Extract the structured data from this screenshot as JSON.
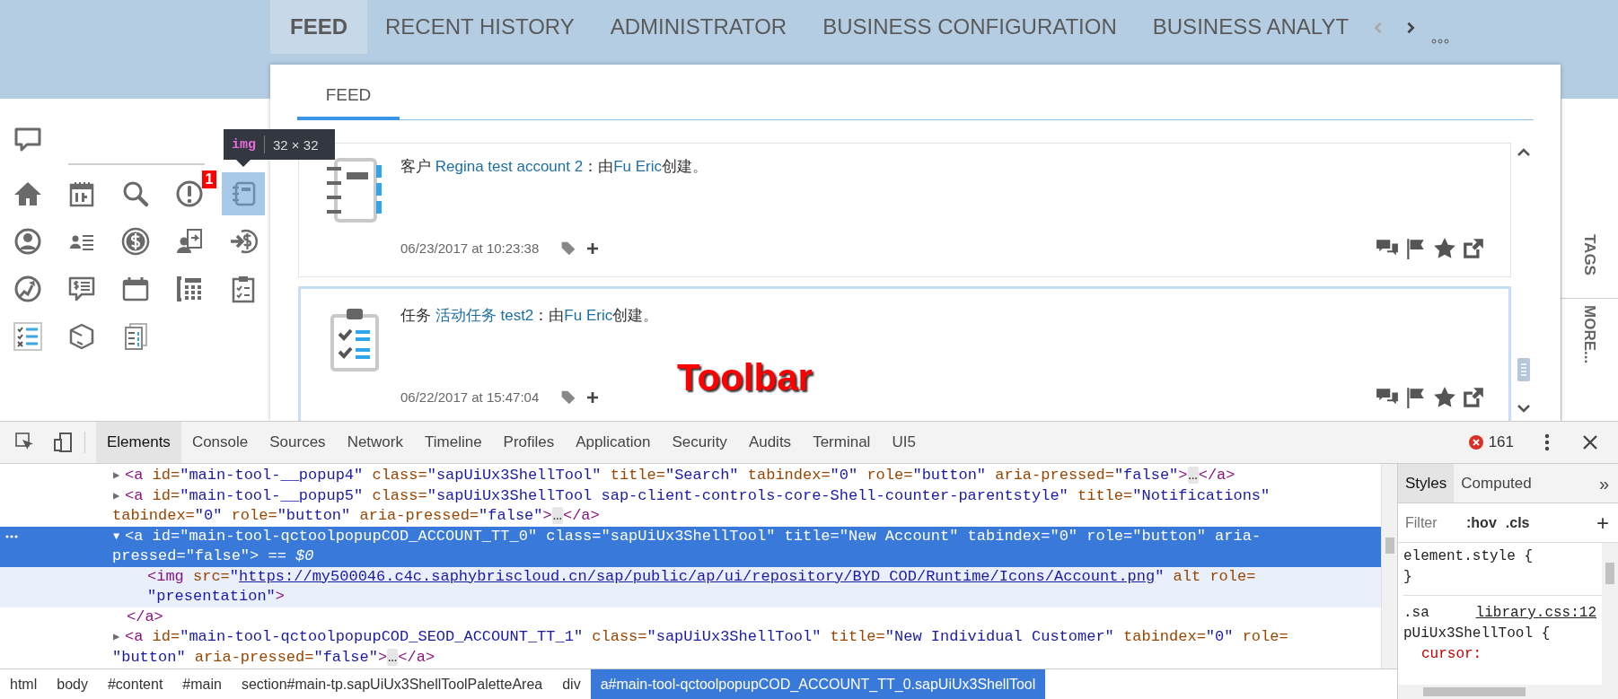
{
  "top_tabs": [
    {
      "label": "FEED",
      "selected": true
    },
    {
      "label": "RECENT HISTORY",
      "selected": false
    },
    {
      "label": "ADMINISTRATOR",
      "selected": false
    },
    {
      "label": "BUSINESS CONFIGURATION",
      "selected": false
    },
    {
      "label": "BUSINESS ANALYT",
      "selected": false
    }
  ],
  "toolbar": {
    "items": [
      {
        "selected": false
      },
      {
        "selected": false
      },
      {
        "selected": false
      },
      {
        "selected": false,
        "badge": "1"
      },
      {
        "selected": true
      },
      {
        "selected": false
      },
      {
        "selected": false
      },
      {
        "selected": false
      },
      {
        "selected": false
      },
      {
        "selected": false
      },
      {
        "selected": false
      },
      {
        "selected": false
      },
      {
        "selected": false
      },
      {
        "selected": false
      },
      {
        "selected": false
      },
      {
        "selected": false
      },
      {
        "selected": false
      },
      {
        "selected": false
      }
    ]
  },
  "inspect_tooltip": {
    "tag": "img",
    "size": "32 × 32"
  },
  "subtabs": [
    {
      "label": "FEED",
      "selected": true
    }
  ],
  "feed": [
    {
      "kind": "account",
      "selected": false,
      "time": "06/23/2017 at 10:23:38",
      "segments": [
        {
          "kind": "text",
          "text": "客户 "
        },
        {
          "kind": "link",
          "text": "Regina test account 2"
        },
        {
          "kind": "text",
          "text": "：由"
        },
        {
          "kind": "link",
          "text": "Fu Eric"
        },
        {
          "kind": "text",
          "text": "创建。"
        }
      ]
    },
    {
      "kind": "task",
      "selected": true,
      "time": "06/22/2017 at 15:47:04",
      "segments": [
        {
          "kind": "text",
          "text": "任务 "
        },
        {
          "kind": "link",
          "text": "活动任务 test2"
        },
        {
          "kind": "text",
          "text": "：由"
        },
        {
          "kind": "link",
          "text": "Fu Eric"
        },
        {
          "kind": "text",
          "text": "创建。"
        }
      ]
    }
  ],
  "side_tabs": [
    {
      "label": "TAGS"
    },
    {
      "label": "MORE..."
    }
  ],
  "annotation": "Toolbar",
  "devtools": {
    "tabs": [
      {
        "label": "Elements",
        "selected": true
      },
      {
        "label": "Console",
        "selected": false
      },
      {
        "label": "Sources",
        "selected": false
      },
      {
        "label": "Network",
        "selected": false
      },
      {
        "label": "Timeline",
        "selected": false
      },
      {
        "label": "Profiles",
        "selected": false
      },
      {
        "label": "Application",
        "selected": false
      },
      {
        "label": "Security",
        "selected": false
      },
      {
        "label": "Audits",
        "selected": false
      },
      {
        "label": "Terminal",
        "selected": false
      },
      {
        "label": "UI5",
        "selected": false
      }
    ],
    "error_count": "161",
    "lines": [
      {
        "kind": "open",
        "toggle": "▶",
        "selected": false,
        "hovered": false,
        "tokens": [
          {
            "kind": "tag",
            "text": "<a"
          },
          {
            "kind": "attr",
            "text": " id="
          },
          {
            "kind": "value",
            "text": "\"main-tool-__popup4\""
          },
          {
            "kind": "attr",
            "text": " class="
          },
          {
            "kind": "value",
            "text": "\"sapUiUx3ShellTool\""
          },
          {
            "kind": "attr",
            "text": " title="
          },
          {
            "kind": "value",
            "text": "\"Search\""
          },
          {
            "kind": "attr",
            "text": " tabindex="
          },
          {
            "kind": "value",
            "text": "\"0\""
          },
          {
            "kind": "attr",
            "text": " role="
          },
          {
            "kind": "value",
            "text": "\"button\""
          },
          {
            "kind": "attr",
            "text": " aria-pressed="
          },
          {
            "kind": "value",
            "text": "\"false\""
          },
          {
            "kind": "tag",
            "text": ">"
          },
          {
            "kind": "ellipsis",
            "text": "…"
          },
          {
            "kind": "tag",
            "text": "</a>"
          }
        ]
      },
      {
        "kind": "open",
        "toggle": "▶",
        "selected": false,
        "hovered": false,
        "tokens": [
          {
            "kind": "tag",
            "text": "<a"
          },
          {
            "kind": "attr",
            "text": " id="
          },
          {
            "kind": "value",
            "text": "\"main-tool-__popup5\""
          },
          {
            "kind": "attr",
            "text": " class="
          },
          {
            "kind": "value",
            "text": "\"sapUiUx3ShellTool sap-client-controls-core-Shell-counter-parentstyle\""
          },
          {
            "kind": "attr",
            "text": " title="
          },
          {
            "kind": "value",
            "text": "\"Notifications\""
          }
        ]
      },
      {
        "kind": "wrap",
        "selected": false,
        "hovered": false,
        "tokens": [
          {
            "kind": "attr",
            "text": "tabindex="
          },
          {
            "kind": "value",
            "text": "\"0\""
          },
          {
            "kind": "attr",
            "text": " role="
          },
          {
            "kind": "value",
            "text": "\"button\""
          },
          {
            "kind": "attr",
            "text": " aria-pressed="
          },
          {
            "kind": "value",
            "text": "\"false\""
          },
          {
            "kind": "tag",
            "text": ">"
          },
          {
            "kind": "ellipsis",
            "text": "…"
          },
          {
            "kind": "tag",
            "text": "</a>"
          }
        ]
      },
      {
        "kind": "open",
        "toggle": "▼",
        "selected": true,
        "hovered": false,
        "tokens": [
          {
            "kind": "tag",
            "text": "<a"
          },
          {
            "kind": "attr",
            "text": " id="
          },
          {
            "kind": "value",
            "text": "\"main-tool-qctoolpopupCOD_ACCOUNT_TT_0\""
          },
          {
            "kind": "attr",
            "text": " class="
          },
          {
            "kind": "value",
            "text": "\"sapUiUx3ShellTool\""
          },
          {
            "kind": "attr",
            "text": " title="
          },
          {
            "kind": "value",
            "text": "\"New Account\""
          },
          {
            "kind": "attr",
            "text": " tabindex="
          },
          {
            "kind": "value",
            "text": "\"0\""
          },
          {
            "kind": "attr",
            "text": " role="
          },
          {
            "kind": "value",
            "text": "\"button\""
          },
          {
            "kind": "attr",
            "text": " aria-"
          }
        ]
      },
      {
        "kind": "wrap",
        "selected": true,
        "hovered": false,
        "tokens": [
          {
            "kind": "attr",
            "text": "pressed="
          },
          {
            "kind": "value",
            "text": "\"false\""
          },
          {
            "kind": "tag",
            "text": ">"
          },
          {
            "kind": "ref",
            "text": " == $0"
          }
        ]
      },
      {
        "kind": "child",
        "selected": false,
        "hovered": true,
        "tokens": [
          {
            "kind": "tag",
            "text": "<img"
          },
          {
            "kind": "attr",
            "text": " src="
          },
          {
            "kind": "value",
            "text": "\""
          },
          {
            "kind": "url",
            "text": "https://my500046.c4c.saphybriscloud.cn/sap/public/ap/ui/repository/BYD_COD/Runtime/Icons/Account.png"
          },
          {
            "kind": "value",
            "text": "\""
          },
          {
            "kind": "attr",
            "text": " alt role="
          }
        ]
      },
      {
        "kind": "child",
        "selected": false,
        "hovered": true,
        "tokens": [
          {
            "kind": "value",
            "text": "\"presentation\""
          },
          {
            "kind": "tag",
            "text": ">"
          }
        ]
      },
      {
        "kind": "close",
        "selected": false,
        "hovered": false,
        "tokens": [
          {
            "kind": "tag",
            "text": "</a>"
          }
        ]
      },
      {
        "kind": "open",
        "toggle": "▶",
        "selected": false,
        "hovered": false,
        "tokens": [
          {
            "kind": "tag",
            "text": "<a"
          },
          {
            "kind": "attr",
            "text": " id="
          },
          {
            "kind": "value",
            "text": "\"main-tool-qctoolpopupCOD_SEOD_ACCOUNT_TT_1\""
          },
          {
            "kind": "attr",
            "text": " class="
          },
          {
            "kind": "value",
            "text": "\"sapUiUx3ShellTool\""
          },
          {
            "kind": "attr",
            "text": " title="
          },
          {
            "kind": "value",
            "text": "\"New Individual Customer\""
          },
          {
            "kind": "attr",
            "text": " tabindex="
          },
          {
            "kind": "value",
            "text": "\"0\""
          },
          {
            "kind": "attr",
            "text": " role="
          }
        ]
      },
      {
        "kind": "wrap",
        "selected": false,
        "hovered": false,
        "tokens": [
          {
            "kind": "value",
            "text": "\"button\""
          },
          {
            "kind": "attr",
            "text": " aria-pressed="
          },
          {
            "kind": "value",
            "text": "\"false\""
          },
          {
            "kind": "tag",
            "text": ">"
          },
          {
            "kind": "ellipsis",
            "text": "…"
          },
          {
            "kind": "tag",
            "text": "</a>"
          }
        ]
      }
    ],
    "breadcrumbs": [
      {
        "label": "html",
        "selected": false
      },
      {
        "label": "body",
        "selected": false
      },
      {
        "label": "#content",
        "selected": false
      },
      {
        "label": "#main",
        "selected": false
      },
      {
        "label": "section#main-tp.sapUiUx3ShellToolPaletteArea",
        "selected": false
      },
      {
        "label": "div",
        "selected": false
      },
      {
        "label": "a#main-tool-qctoolpopupCOD_ACCOUNT_TT_0.sapUiUx3ShellTool",
        "selected": true
      }
    ],
    "styles_pane": {
      "tabs": [
        {
          "label": "Styles",
          "selected": true
        },
        {
          "label": "Computed",
          "selected": false
        }
      ],
      "overflow": "»",
      "filter": {
        "placeholder": "Filter"
      },
      "toggles": [
        ":hov",
        ".cls"
      ],
      "add": "+",
      "element_style": [
        "element.style {",
        "}"
      ],
      "rule": {
        "selector_head": ".sa",
        "source": "library.css:12",
        "selector_tail": "pUiUx3ShellTool {",
        "property": "cursor:"
      }
    }
  }
}
